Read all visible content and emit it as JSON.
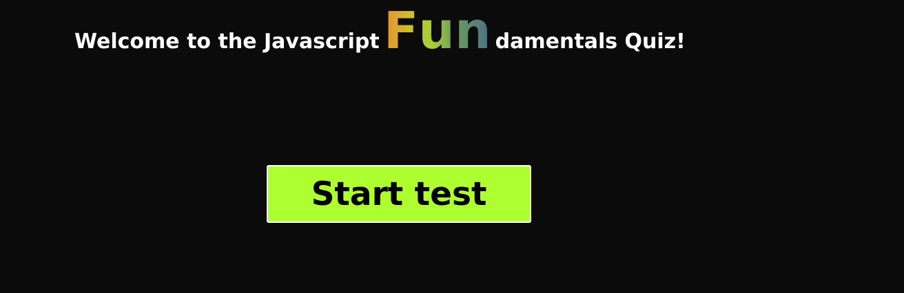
{
  "header": {
    "prefix": "Welcome to the Javascript ",
    "fun_letters": [
      "F",
      "u",
      "n"
    ],
    "suffix": "damentals Quiz!"
  },
  "start_button": {
    "label": "Start test"
  },
  "colors": {
    "background": "#0b0b0b",
    "text": "#ffffff",
    "button_bg": "#adff2f",
    "button_border": "#ffffff",
    "button_text": "#000000",
    "fun_gradient": [
      "#e8912f",
      "#c9c52c",
      "#a3cf39",
      "#6a9860",
      "#4a6f86"
    ]
  }
}
